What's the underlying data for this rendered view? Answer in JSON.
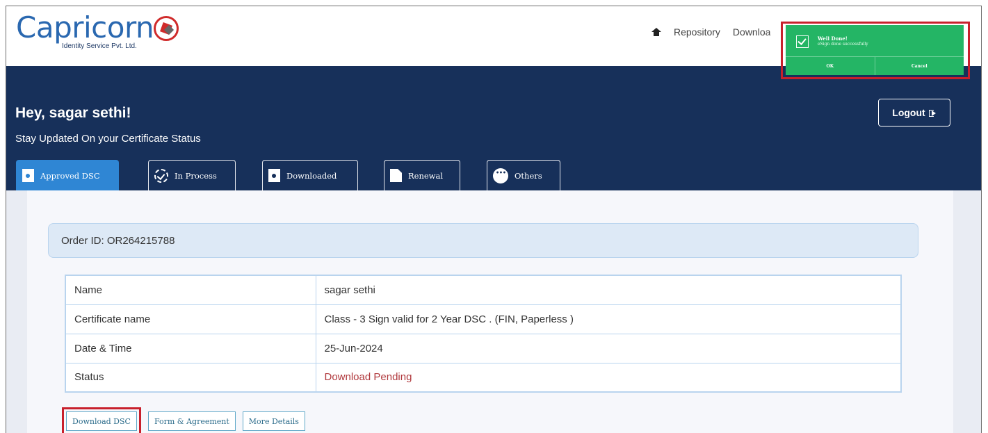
{
  "header": {
    "logo_text": "Capricorn",
    "logo_tagline": "Identity Service Pvt. Ltd.",
    "nav": [
      {
        "label": "Repository"
      },
      {
        "label": "Downloads"
      }
    ]
  },
  "toast": {
    "title": "Well Done!",
    "message": "eSign done successfully",
    "ok_label": "OK",
    "cancel_label": "Cancel",
    "color": "#24b565"
  },
  "banner": {
    "greeting": "Hey, sagar sethi!",
    "subtitle": "Stay Updated On your Certificate Status",
    "logout_label": "Logout",
    "background": "#17305a"
  },
  "tabs": [
    {
      "label": "Approved DSC",
      "icon": "document-icon",
      "active": true
    },
    {
      "label": "In Process",
      "icon": "clock-icon",
      "active": false
    },
    {
      "label": "Downloaded",
      "icon": "document-icon",
      "active": false
    },
    {
      "label": "Renewal",
      "icon": "page-icon",
      "active": false
    },
    {
      "label": "Others",
      "icon": "more-dots-icon",
      "active": false
    }
  ],
  "order": {
    "label": "Order ID: OR264215788"
  },
  "details": [
    {
      "key": "Name",
      "value": "sagar sethi"
    },
    {
      "key": "Certificate name",
      "value": "Class - 3 Sign valid for 2 Year DSC . (FIN, Paperless )"
    },
    {
      "key": "Date & Time",
      "value": "25-Jun-2024"
    },
    {
      "key": "Status",
      "value": "Download Pending",
      "status_color": "#b0383c"
    }
  ],
  "actions": {
    "download_label": "Download DSC",
    "form_label": "Form & Agreement",
    "more_label": "More Details"
  }
}
